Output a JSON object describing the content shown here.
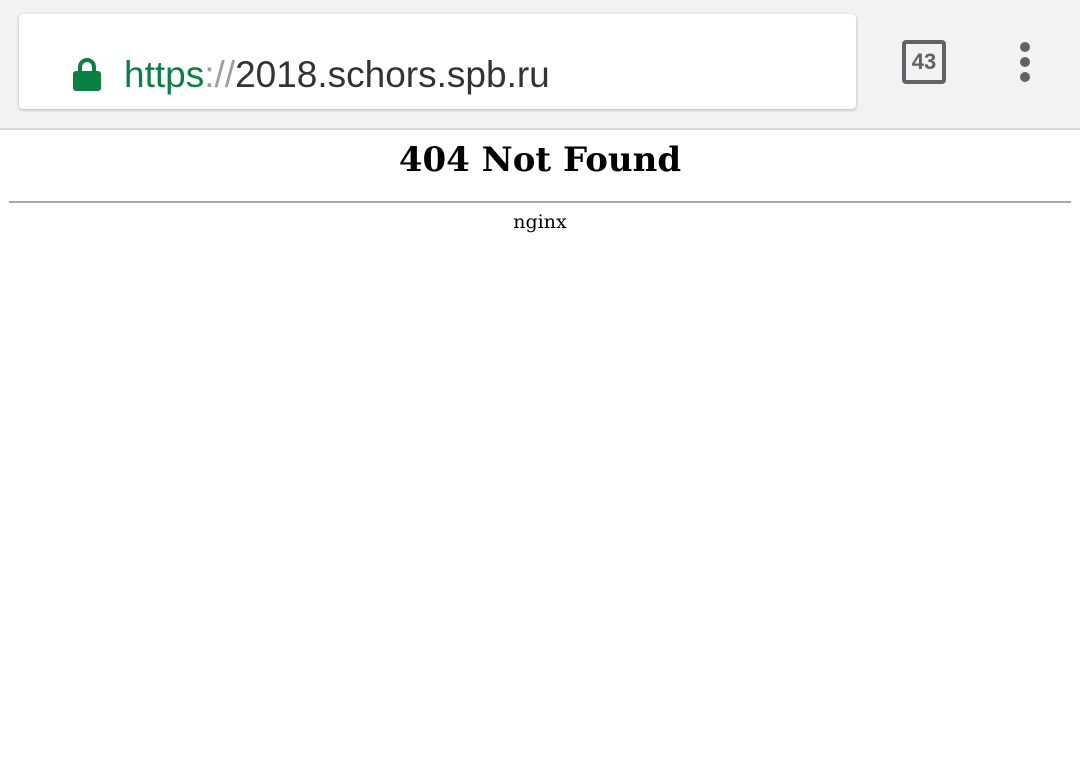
{
  "browser": {
    "url": {
      "scheme": "https",
      "separator": "://",
      "host": "2018.schors.spb.ru"
    },
    "tab_count": "43",
    "lock_icon": "lock-icon",
    "menu_icon": "more-vert-icon",
    "colors": {
      "secure_green": "#0b8043",
      "icon_gray": "#5f6368",
      "toolbar_bg": "#f2f2f2"
    }
  },
  "page": {
    "title": "404 Not Found",
    "server": "nginx"
  }
}
